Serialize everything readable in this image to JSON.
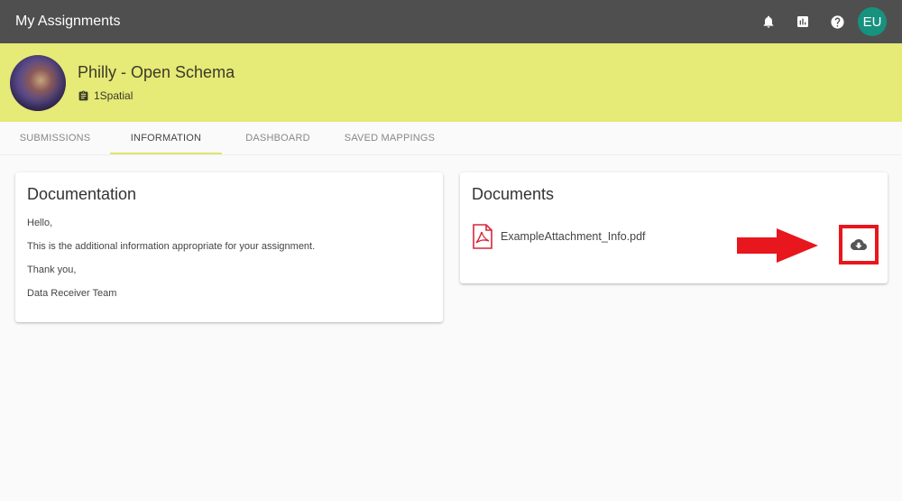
{
  "topbar": {
    "title": "My Assignments",
    "icons": [
      "bell-icon",
      "bar-chart-icon",
      "help-icon"
    ],
    "user_initials": "EU",
    "user_avatar_color": "#16927f"
  },
  "banner": {
    "name": "Philly - Open Schema",
    "organization": "1Spatial",
    "background_color": "#e6ea76"
  },
  "tabs": [
    {
      "label": "SUBMISSIONS",
      "active": false
    },
    {
      "label": "INFORMATION",
      "active": true
    },
    {
      "label": "DASHBOARD",
      "active": false
    },
    {
      "label": "SAVED MAPPINGS",
      "active": false
    }
  ],
  "documentation": {
    "title": "Documentation",
    "paragraphs": [
      "Hello,",
      "This is the additional information appropriate for your assignment.",
      "Thank you,",
      "Data Receiver Team"
    ]
  },
  "documents": {
    "title": "Documents",
    "files": [
      {
        "name": "ExampleAttachment_Info.pdf",
        "icon": "pdf-icon",
        "action_icon": "cloud-download-icon"
      }
    ],
    "annotation_color": "#e8161d"
  }
}
